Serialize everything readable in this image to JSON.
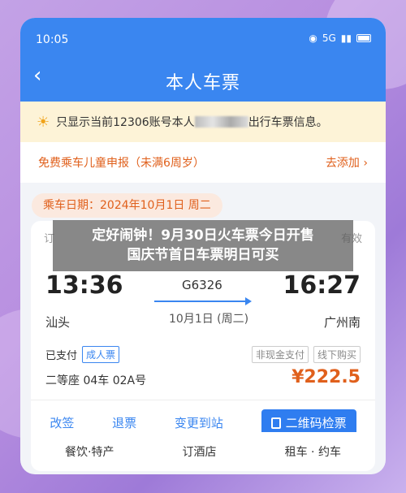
{
  "status": {
    "time": "10:05",
    "signal": "5G"
  },
  "nav": {
    "title": "本人车票"
  },
  "notice": {
    "prefix": "只显示当前12306账号本人",
    "suffix": "出行车票信息。"
  },
  "child": {
    "label": "免费乘车儿童申报（未满6周岁）",
    "action": "去添加 ›"
  },
  "trip": {
    "date_label": "乘车日期：2024年10月1日 周二"
  },
  "card": {
    "head_left": "订",
    "head_right": "有效",
    "depart_time": "13:36",
    "arrive_time": "16:27",
    "train_no": "G6326",
    "depart_station": "汕头",
    "arrive_station": "广州南",
    "date": "10月1日 (周二)",
    "paid": "已支付",
    "ticket_type": "成人票",
    "tag1": "非现金支付",
    "tag2": "线下购买",
    "seat": "二等座 04车 02A号",
    "price": "¥222.5"
  },
  "actions": [
    "改签",
    "退票",
    "变更到站",
    "二维码检票"
  ],
  "services": [
    "餐饮·特产",
    "订酒店",
    "租车 · 约车"
  ],
  "overlay": {
    "line1": "定好闹钟！9月30日火车票今日开售",
    "line2": "国庆节首日车票明日可买"
  }
}
